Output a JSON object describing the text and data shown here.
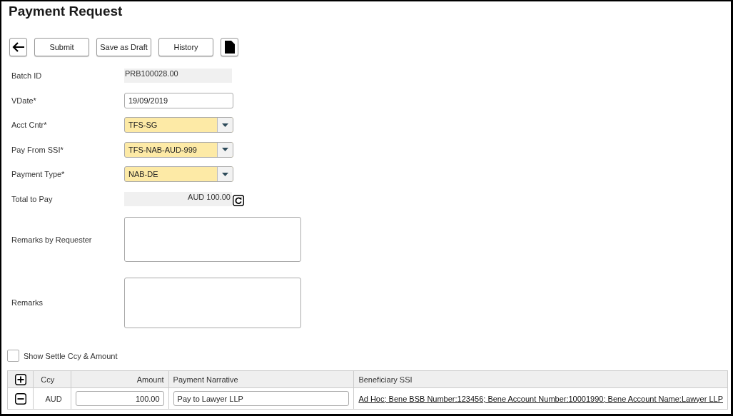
{
  "title": "Payment Request",
  "toolbar": [
    {
      "kind": "back"
    },
    {
      "kind": "text",
      "label": "Submit"
    },
    {
      "kind": "text",
      "label": "Save as Draft"
    },
    {
      "kind": "text",
      "label": "History"
    },
    {
      "kind": "document"
    }
  ],
  "fields": [
    {
      "kind": "readonly",
      "label": "Batch ID",
      "value": "PRB100028.00"
    },
    {
      "kind": "input",
      "label": "VDate*",
      "value": "19/09/2019"
    },
    {
      "kind": "select",
      "label": "Acct Cntr*",
      "value": "TFS-SG"
    },
    {
      "kind": "select",
      "label": "Pay From SSI*",
      "value": "TFS-NAB-AUD-999"
    },
    {
      "kind": "select",
      "label": "Payment Type*",
      "value": "NAB-DE"
    },
    {
      "kind": "total",
      "label": "Total to Pay",
      "value": "AUD 100.00"
    },
    {
      "kind": "textarea",
      "label": "Remarks by Requester"
    },
    {
      "kind": "textarea",
      "label": "Remarks"
    }
  ],
  "settle_checkbox": {
    "label": "Show Settle Ccy & Amount",
    "checked": false
  },
  "table": {
    "columns": [
      "Ccy",
      "Amount",
      "Payment Narrative",
      "Beneficiary SSI"
    ],
    "rows": [
      {
        "ccy": "AUD",
        "amount": "100.00",
        "narrative": "Pay to Lawyer LLP",
        "beneficiary": "Ad Hoc; Bene BSB Number:123456; Bene Account Number:10001990; Bene Account Name:Lawyer LLP"
      }
    ]
  }
}
